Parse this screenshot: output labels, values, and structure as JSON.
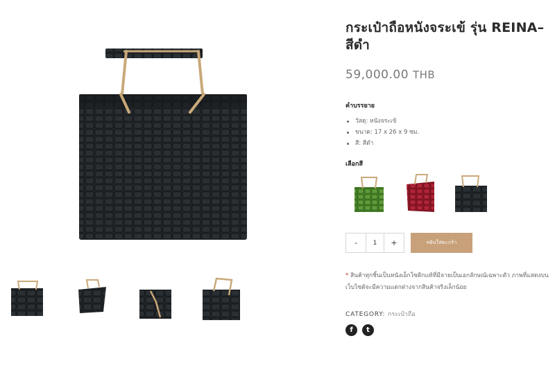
{
  "product": {
    "title": "กระเป๋าถือหนังจระเข้ รุ่น REINA–สีดำ",
    "price": "59,000.00",
    "currency": "THB",
    "description_label": "คำบรรยาย",
    "details": [
      "วัสดุ: หนังจระเข้",
      "ขนาด: 17 x 26 x 9 ซม.",
      "สี: สีดำ"
    ],
    "color_label": "เลือกสี",
    "colors": [
      {
        "name": "green",
        "hex": "#4e8a2c"
      },
      {
        "name": "red",
        "hex": "#9c1a2c"
      },
      {
        "name": "black",
        "hex": "#1f2326"
      }
    ]
  },
  "purchase": {
    "minus": "-",
    "quantity": "1",
    "plus": "+",
    "add_to_cart": "หยิบใส่ตะกร้า"
  },
  "note": {
    "marker": "*",
    "text": "สินค้าทุกชิ้นเป็นหนังเอ็กโซติกแท้ที่มีลายเป็นเอกลักษณ์เฉพาะตัว ภาพที่แสดงบนเว็บไซต์จะมีความแตกต่างจากสินค้าจริงเล็กน้อย"
  },
  "meta": {
    "category_label": "CATEGORY:",
    "category_value": "กระเป๋าถือ"
  },
  "social": {
    "facebook_glyph": "f",
    "twitter_glyph": "t"
  },
  "colors": {
    "accent": "#c8a17a",
    "leather": "#1f2326",
    "handle": "#c9a97a"
  }
}
